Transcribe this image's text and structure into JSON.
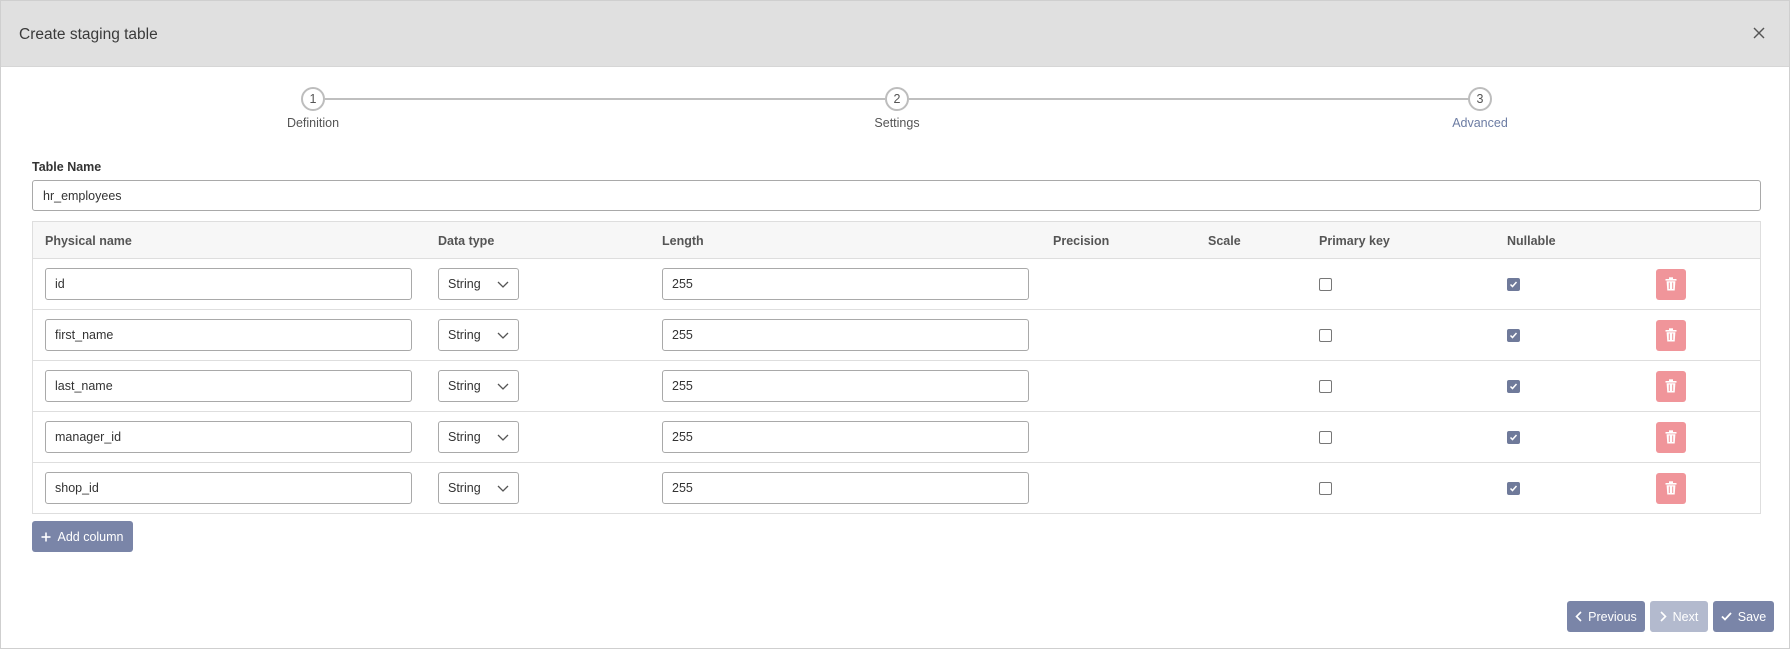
{
  "dialog": {
    "title": "Create staging table",
    "close_icon": "close-icon"
  },
  "stepper": {
    "steps": [
      {
        "number": "1",
        "label": "Definition",
        "active": false
      },
      {
        "number": "2",
        "label": "Settings",
        "active": false
      },
      {
        "number": "3",
        "label": "Advanced",
        "active": true
      }
    ]
  },
  "table_name": {
    "label": "Table Name",
    "value": "hr_employees"
  },
  "grid": {
    "columns": [
      "Physical name",
      "Data type",
      "Length",
      "Precision",
      "Scale",
      "Primary key",
      "Nullable"
    ],
    "rows": [
      {
        "physical_name": "id",
        "data_type": "String",
        "length": "255",
        "primary_key": false,
        "nullable": true
      },
      {
        "physical_name": "first_name",
        "data_type": "String",
        "length": "255",
        "primary_key": false,
        "nullable": true
      },
      {
        "physical_name": "last_name",
        "data_type": "String",
        "length": "255",
        "primary_key": false,
        "nullable": true
      },
      {
        "physical_name": "manager_id",
        "data_type": "String",
        "length": "255",
        "primary_key": false,
        "nullable": true
      },
      {
        "physical_name": "shop_id",
        "data_type": "String",
        "length": "255",
        "primary_key": false,
        "nullable": true
      }
    ]
  },
  "buttons": {
    "add_column": "Add column",
    "previous": "Previous",
    "next": "Next",
    "save": "Save"
  },
  "colors": {
    "primary": "#7a85a8",
    "disabled": "#b3bace",
    "danger": "#f0959a",
    "active_step": "#6c7ca3",
    "header_bg": "#e0e0e0"
  }
}
